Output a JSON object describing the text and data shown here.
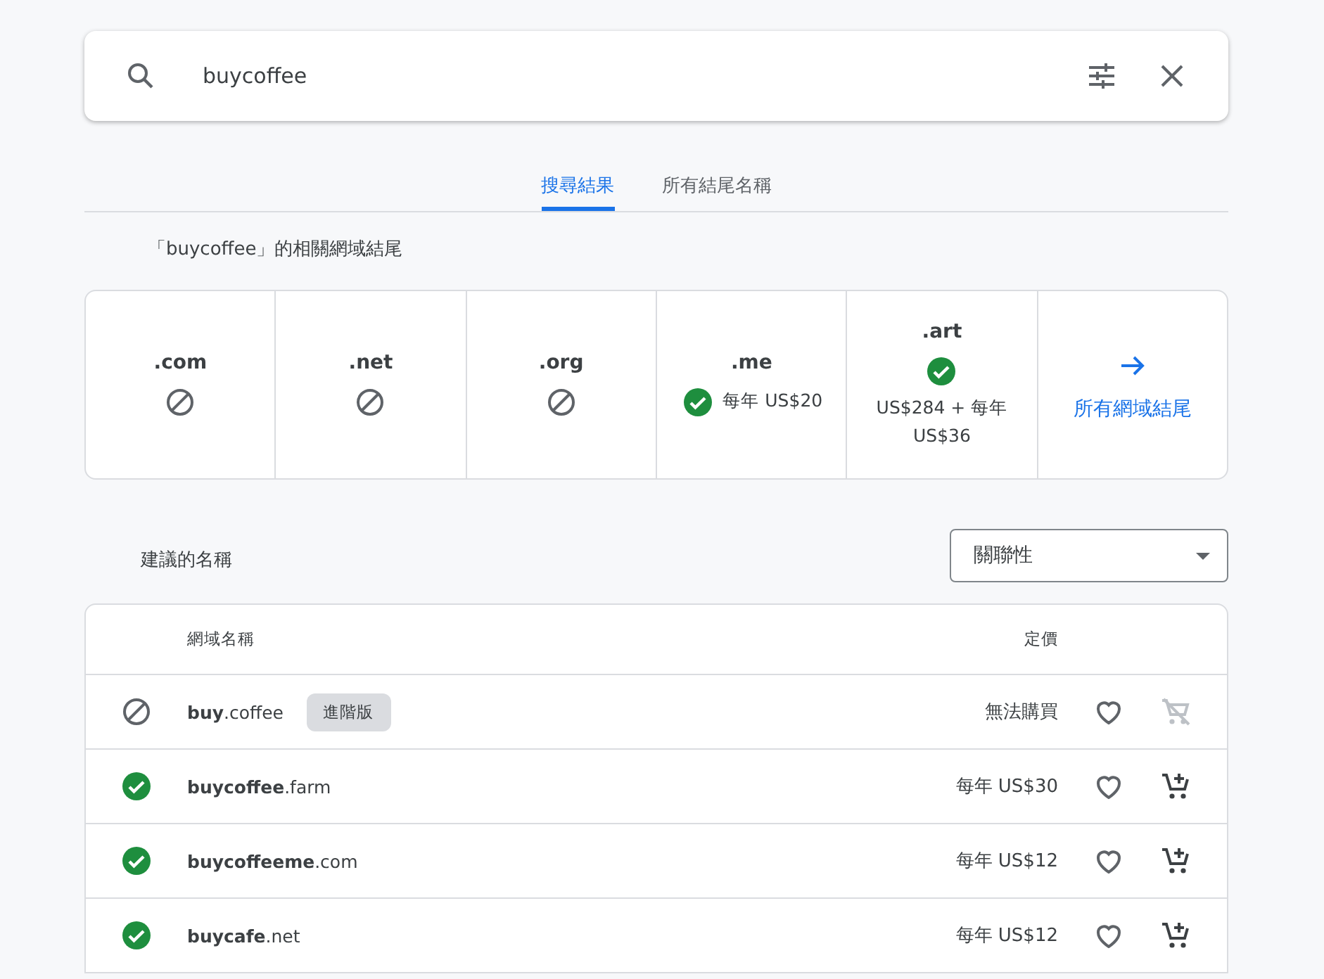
{
  "search": {
    "value": "buycoffee"
  },
  "tabs": [
    {
      "label": "搜尋結果",
      "selected": true
    },
    {
      "label": "所有結尾名稱",
      "selected": false
    }
  ],
  "related_heading": "「buycoffee」的相關網域結尾",
  "tlds": [
    {
      "kind": "tld",
      "name": ".com",
      "available": false
    },
    {
      "kind": "tld",
      "name": ".net",
      "available": false
    },
    {
      "kind": "tld",
      "name": ".org",
      "available": false
    },
    {
      "kind": "tld",
      "name": ".me",
      "available": true,
      "price": "每年 US$20",
      "inline": true
    },
    {
      "kind": "tld",
      "name": ".art",
      "available": true,
      "price": "US$284 + 每年 US$36",
      "inline": false
    },
    {
      "kind": "link",
      "label": "所有網域結尾"
    }
  ],
  "suggested_heading": "建議的名稱",
  "sort": {
    "value": "關聯性"
  },
  "table": {
    "columns": [
      "網域名稱",
      "定價"
    ],
    "rows": [
      {
        "domain": "**buy**.coffee",
        "available": false,
        "badge": "進階版",
        "price": "無法購買"
      },
      {
        "domain": "**buycoffee**.farm",
        "available": true,
        "price": "每年 US$30"
      },
      {
        "domain": "**buycoffeeme**.com",
        "available": true,
        "price": "每年 US$12"
      },
      {
        "domain": "**buycafe**.net",
        "available": true,
        "price": "每年 US$12"
      }
    ]
  }
}
